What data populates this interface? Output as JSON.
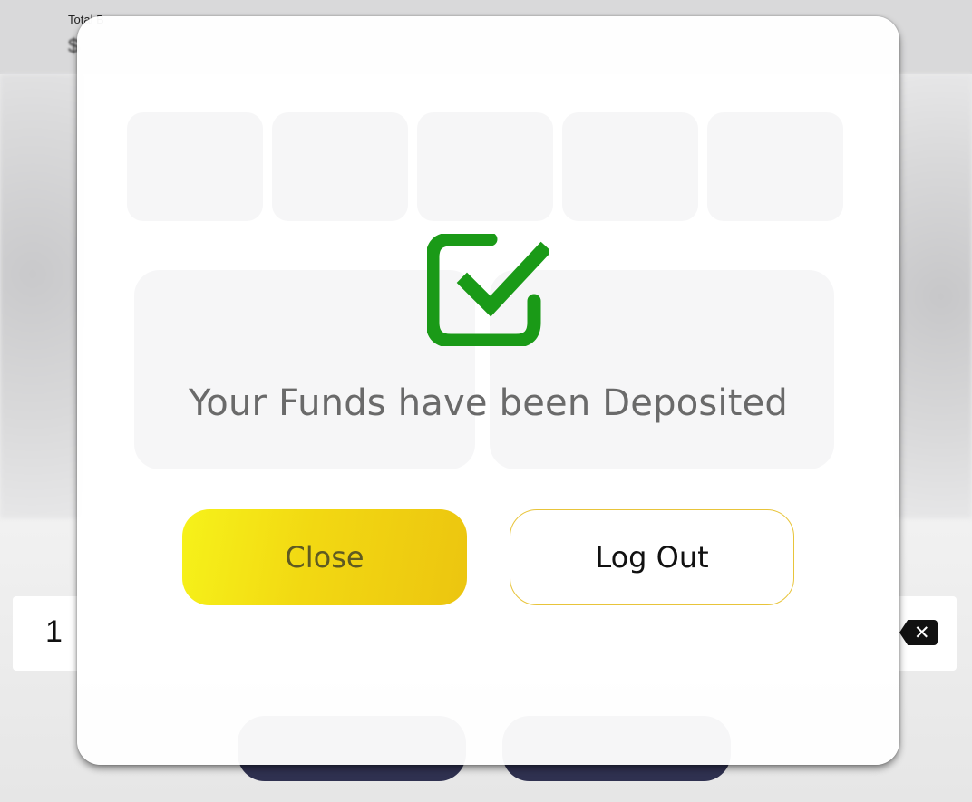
{
  "background": {
    "balance_label": "Total B",
    "balance_value": "$",
    "keypad_first_key": "1",
    "backspace_glyph": "✕"
  },
  "dialog": {
    "icon": "green-checkbox-check-icon",
    "message": "Your Funds have been Deposited",
    "close_label": "Close",
    "logout_label": "Log Out"
  },
  "colors": {
    "accent_yellow": "#f6e215",
    "success_green": "#1a9a17",
    "overlay_text": "#6a6a6a",
    "dark_button": "#2f3150"
  }
}
